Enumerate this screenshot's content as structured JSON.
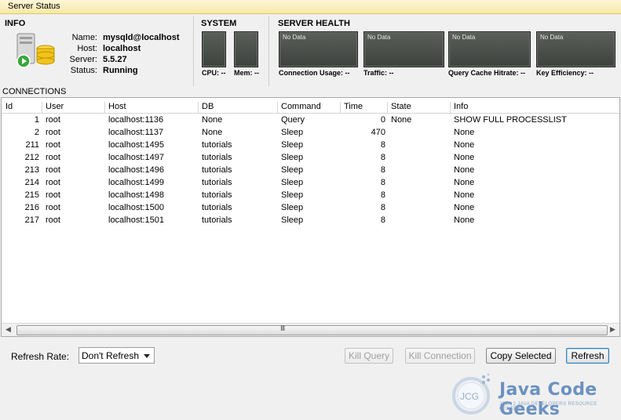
{
  "window": {
    "title": "Server Status"
  },
  "info": {
    "section_title": "INFO",
    "labels": {
      "name": "Name:",
      "host": "Host:",
      "server": "Server:",
      "status": "Status:"
    },
    "values": {
      "name": "mysqld@localhost",
      "host": "localhost",
      "server": "5.5.27",
      "status": "Running"
    },
    "icon": "server-database-running-icon"
  },
  "system": {
    "section_title": "SYSTEM",
    "cpu_label": "CPU: --",
    "mem_label": "Mem: --"
  },
  "health": {
    "section_title": "SERVER HEALTH",
    "no_data": "No Data",
    "gauges": [
      {
        "label": "Connection Usage: --"
      },
      {
        "label": "Traffic: --"
      },
      {
        "label": "Query Cache Hitrate: --"
      },
      {
        "label": "Key Efficiency: --"
      }
    ]
  },
  "connections": {
    "section_title": "CONNECTIONS",
    "columns": [
      "Id",
      "User",
      "Host",
      "DB",
      "Command",
      "Time",
      "State",
      "Info"
    ],
    "rows": [
      {
        "id": "1",
        "user": "root",
        "host": "localhost:1136",
        "db": "None",
        "command": "Query",
        "time": "0",
        "state": "None",
        "info": "SHOW FULL PROCESSLIST"
      },
      {
        "id": "2",
        "user": "root",
        "host": "localhost:1137",
        "db": "None",
        "command": "Sleep",
        "time": "470",
        "state": "",
        "info": "None"
      },
      {
        "id": "211",
        "user": "root",
        "host": "localhost:1495",
        "db": "tutorials",
        "command": "Sleep",
        "time": "8",
        "state": "",
        "info": "None"
      },
      {
        "id": "212",
        "user": "root",
        "host": "localhost:1497",
        "db": "tutorials",
        "command": "Sleep",
        "time": "8",
        "state": "",
        "info": "None"
      },
      {
        "id": "213",
        "user": "root",
        "host": "localhost:1496",
        "db": "tutorials",
        "command": "Sleep",
        "time": "8",
        "state": "",
        "info": "None"
      },
      {
        "id": "214",
        "user": "root",
        "host": "localhost:1499",
        "db": "tutorials",
        "command": "Sleep",
        "time": "8",
        "state": "",
        "info": "None"
      },
      {
        "id": "215",
        "user": "root",
        "host": "localhost:1498",
        "db": "tutorials",
        "command": "Sleep",
        "time": "8",
        "state": "",
        "info": "None"
      },
      {
        "id": "216",
        "user": "root",
        "host": "localhost:1500",
        "db": "tutorials",
        "command": "Sleep",
        "time": "8",
        "state": "",
        "info": "None"
      },
      {
        "id": "217",
        "user": "root",
        "host": "localhost:1501",
        "db": "tutorials",
        "command": "Sleep",
        "time": "8",
        "state": "",
        "info": "None"
      }
    ],
    "scroll_grip": "III"
  },
  "watermark": {
    "brand": "Java Code Geeks",
    "tagline": "JAVA 2 JAVA DEVELOPERS RESOURCE CENTER",
    "logo_text": "JCG"
  },
  "footer": {
    "refresh_rate_label": "Refresh Rate:",
    "refresh_rate_value": "Don't Refresh",
    "kill_query": "Kill Query",
    "kill_connection": "Kill Connection",
    "copy_selected": "Copy Selected",
    "refresh": "Refresh"
  },
  "colors": {
    "title_bar": "#f7e9a8",
    "gauge_bg": "#4a4f4a",
    "watermark": "#6b91c0"
  }
}
